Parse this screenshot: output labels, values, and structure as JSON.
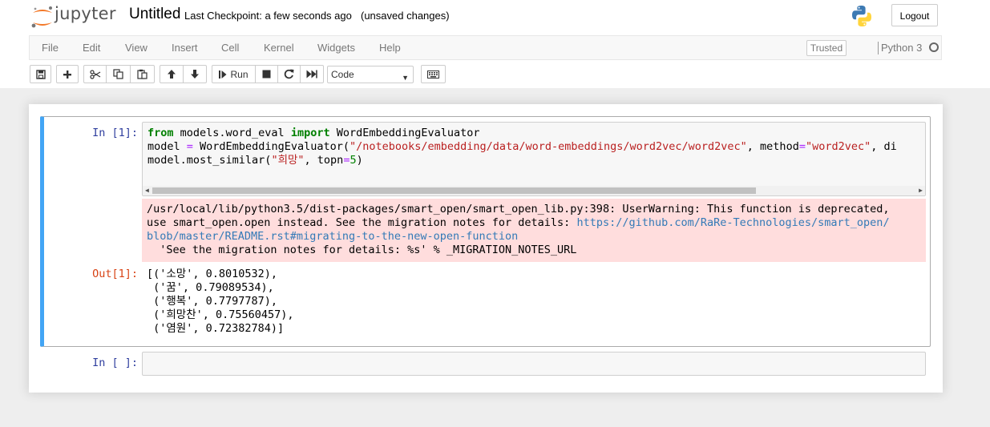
{
  "header": {
    "logo_text": "jupyter",
    "notebook_title": "Untitled",
    "checkpoint": "Last Checkpoint: a few seconds ago",
    "unsaved": "(unsaved changes)",
    "logout_label": "Logout"
  },
  "menubar": {
    "items": [
      "File",
      "Edit",
      "View",
      "Insert",
      "Cell",
      "Kernel",
      "Widgets",
      "Help"
    ],
    "trusted_label": "Trusted",
    "kernel_name": "Python 3"
  },
  "toolbar": {
    "run_label": "Run",
    "cell_type": "Code",
    "buttons": [
      "save-icon",
      "plus-icon",
      "cut-icon",
      "copy-icon",
      "paste-icon",
      "arrow-up-icon",
      "arrow-down-icon",
      "run-icon",
      "stop-icon",
      "restart-icon",
      "fast-forward-icon",
      "keyboard-icon"
    ]
  },
  "cells": {
    "cell1": {
      "in_prompt": "In [1]:",
      "code": [
        [
          "from",
          " models.word_eval ",
          "import",
          " WordEmbeddingEvaluator"
        ],
        [
          "model ",
          "=",
          " WordEmbeddingEvaluator(",
          "\"/notebooks/embedding/data/word-embeddings/word2vec/word2vec\"",
          ", method",
          "=",
          "\"word2vec\"",
          ", di"
        ],
        [
          "model.most_similar(",
          "\"희망\"",
          ", topn",
          "=",
          "5",
          ")"
        ]
      ],
      "stderr_lines": [
        "/usr/local/lib/python3.5/dist-packages/smart_open/smart_open_lib.py:398: UserWarning: This function is deprecated,",
        "use smart_open.open instead. See the migration notes for details: ",
        "https://github.com/RaRe-Technologies/smart_open/",
        "blob/master/README.rst#migrating-to-the-new-open-function",
        "  'See the migration notes for details: %s' % _MIGRATION_NOTES_URL"
      ],
      "out_prompt": "Out[1]:",
      "output_lines": [
        "[('소망', 0.8010532),",
        " ('꿈', 0.79089534),",
        " ('행복', 0.7797787),",
        " ('희망찬', 0.75560457),",
        " ('염원', 0.72382784)]"
      ]
    },
    "cell2": {
      "in_prompt": "In [ ]:"
    }
  }
}
